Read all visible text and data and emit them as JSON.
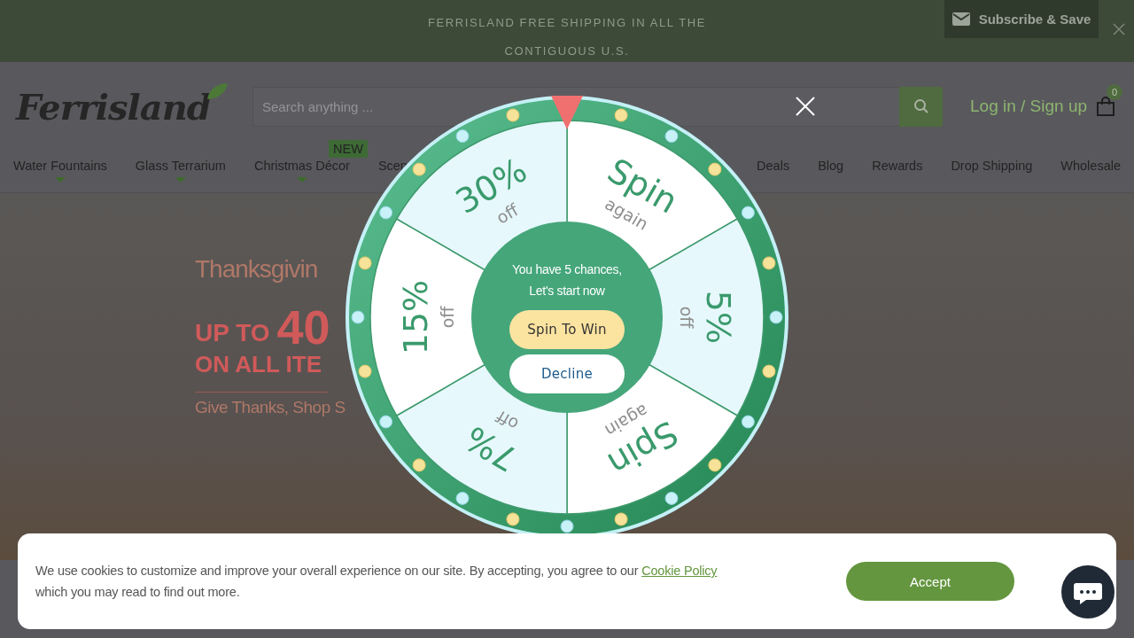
{
  "announcement": {
    "text": "FERRISLAND FREE SHIPPING IN ALL THE CONTIGUOUS U.S.",
    "subscribe_button": "Subscribe & Save"
  },
  "header": {
    "logo": "Ferrisland",
    "search": {
      "placeholder": "Search anything ..."
    },
    "account_link": "Log in / Sign up",
    "cart_count": "0"
  },
  "nav_left": [
    {
      "label": "Water Fountains",
      "dropdown": true
    },
    {
      "label": "Glass Terrarium",
      "dropdown": true
    },
    {
      "label": "Christmas Décor",
      "dropdown": true,
      "badge": "NEW"
    },
    {
      "label": "Scen",
      "dropdown": false
    }
  ],
  "nav_right": [
    {
      "label": "Deals",
      "dropdown": false
    },
    {
      "label": "Blog",
      "dropdown": false
    },
    {
      "label": "Rewards",
      "dropdown": false
    },
    {
      "label": "Drop Shipping",
      "dropdown": false
    },
    {
      "label": "Wholesale",
      "dropdown": false
    }
  ],
  "hero": {
    "title": "Thanksgivin",
    "offer_prefix": "UP TO",
    "offer_value": "40",
    "offer_line": "ON ALL ITE",
    "tagline": "Give Thanks, Shop S"
  },
  "wheel": {
    "segments": [
      {
        "value": "Spin",
        "note": "again",
        "color": "#ffffff"
      },
      {
        "value": "5%",
        "note": "off",
        "color": "#e6f8fc"
      },
      {
        "value": "Spin",
        "note": "again",
        "color": "#ffffff"
      },
      {
        "value": "7%",
        "note": "off",
        "color": "#e6f8fc"
      },
      {
        "value": "15%",
        "note": "off",
        "color": "#ffffff"
      },
      {
        "value": "30%",
        "note": "off",
        "color": "#e6f8fc"
      }
    ],
    "message": "You have 5 chances, Let's start now",
    "spin_button": "Spin To Win",
    "decline_button": "Decline"
  },
  "cookie_banner": {
    "text": "We use cookies to customize and improve your overall experience on our site. By accepting, you agree to our",
    "link": "Cookie Policy",
    "text_after": "which you may read to find out more.",
    "accept_button": "Accept"
  }
}
